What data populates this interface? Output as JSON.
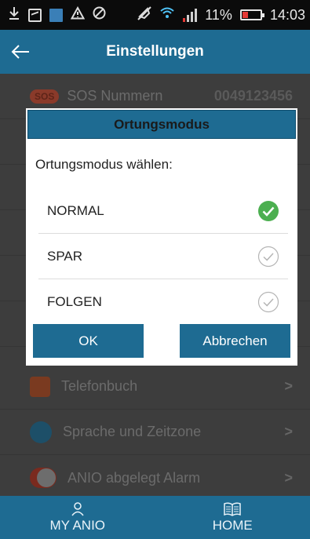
{
  "status_bar": {
    "battery": "11%",
    "time": "14:03",
    "icons": [
      "download-icon",
      "image-icon",
      "app-icon",
      "warning-icon",
      "blocked-icon",
      "mute-icon",
      "wifi-icon",
      "signal-icon",
      "battery-icon"
    ]
  },
  "app_bar": {
    "title": "Einstellungen",
    "back_icon": "arrow-left-icon"
  },
  "background": {
    "sos_badge": "SOS",
    "sos_label": "SOS Nummern",
    "sos_value": "0049123456",
    "items": [
      {
        "label": "Telefonbuch",
        "chevron": ">",
        "icon": "phonebook-icon"
      },
      {
        "label": "Sprache und Zeitzone",
        "chevron": ">",
        "icon": "language-icon"
      },
      {
        "label": "ANIO abgelegt Alarm",
        "chevron": ">",
        "icon": "toggle-icon"
      }
    ]
  },
  "dialog": {
    "title": "Ortungsmodus",
    "prompt": "Ortungsmodus wählen:",
    "options": [
      {
        "label": "NORMAL",
        "selected": true
      },
      {
        "label": "SPAR",
        "selected": false
      },
      {
        "label": "FOLGEN",
        "selected": false
      }
    ],
    "ok_label": "OK",
    "cancel_label": "Abbrechen"
  },
  "bottom_nav": {
    "tabs": [
      {
        "label": "MY ANIO",
        "icon": "person-icon"
      },
      {
        "label": "HOME",
        "icon": "book-icon"
      }
    ]
  },
  "colors": {
    "primary": "#1e6b92",
    "check_green": "#4caf50",
    "battery_low": "#e53935"
  }
}
